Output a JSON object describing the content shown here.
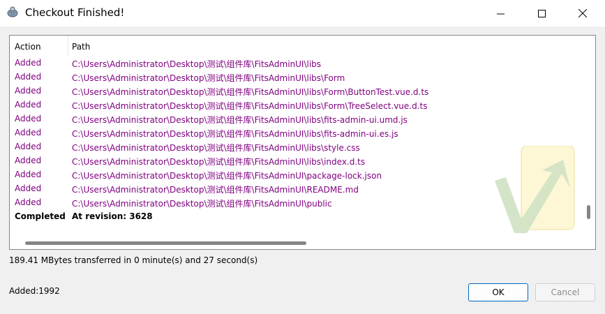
{
  "window": {
    "title": "Checkout Finished!",
    "icon": "tortoisesvn-icon"
  },
  "list": {
    "columns": [
      "Action",
      "Path"
    ],
    "rows": [
      {
        "action": "Added",
        "path": "C:\\Users\\Administrator\\Desktop\\测试\\组件库\\FitsAdminUI\\libs"
      },
      {
        "action": "Added",
        "path": "C:\\Users\\Administrator\\Desktop\\测试\\组件库\\FitsAdminUI\\libs\\Form"
      },
      {
        "action": "Added",
        "path": "C:\\Users\\Administrator\\Desktop\\测试\\组件库\\FitsAdminUI\\libs\\Form\\ButtonTest.vue.d.ts"
      },
      {
        "action": "Added",
        "path": "C:\\Users\\Administrator\\Desktop\\测试\\组件库\\FitsAdminUI\\libs\\Form\\TreeSelect.vue.d.ts"
      },
      {
        "action": "Added",
        "path": "C:\\Users\\Administrator\\Desktop\\测试\\组件库\\FitsAdminUI\\libs\\fits-admin-ui.umd.js"
      },
      {
        "action": "Added",
        "path": "C:\\Users\\Administrator\\Desktop\\测试\\组件库\\FitsAdminUI\\libs\\fits-admin-ui.es.js"
      },
      {
        "action": "Added",
        "path": "C:\\Users\\Administrator\\Desktop\\测试\\组件库\\FitsAdminUI\\libs\\style.css"
      },
      {
        "action": "Added",
        "path": "C:\\Users\\Administrator\\Desktop\\测试\\组件库\\FitsAdminUI\\libs\\index.d.ts"
      },
      {
        "action": "Added",
        "path": "C:\\Users\\Administrator\\Desktop\\测试\\组件库\\FitsAdminUI\\package-lock.json"
      },
      {
        "action": "Added",
        "path": "C:\\Users\\Administrator\\Desktop\\测试\\组件库\\FitsAdminUI\\README.md"
      },
      {
        "action": "Added",
        "path": "C:\\Users\\Administrator\\Desktop\\测试\\组件库\\FitsAdminUI\\public"
      },
      {
        "action": "Completed",
        "path": "At revision: 3628"
      }
    ]
  },
  "status": {
    "transfer": "189.41 MBytes transferred in 0 minute(s) and 27 second(s)",
    "added_count": "Added:1992"
  },
  "buttons": {
    "ok": "OK",
    "cancel": "Cancel"
  },
  "colors": {
    "added": "#800080",
    "accent": "#0067c0"
  }
}
